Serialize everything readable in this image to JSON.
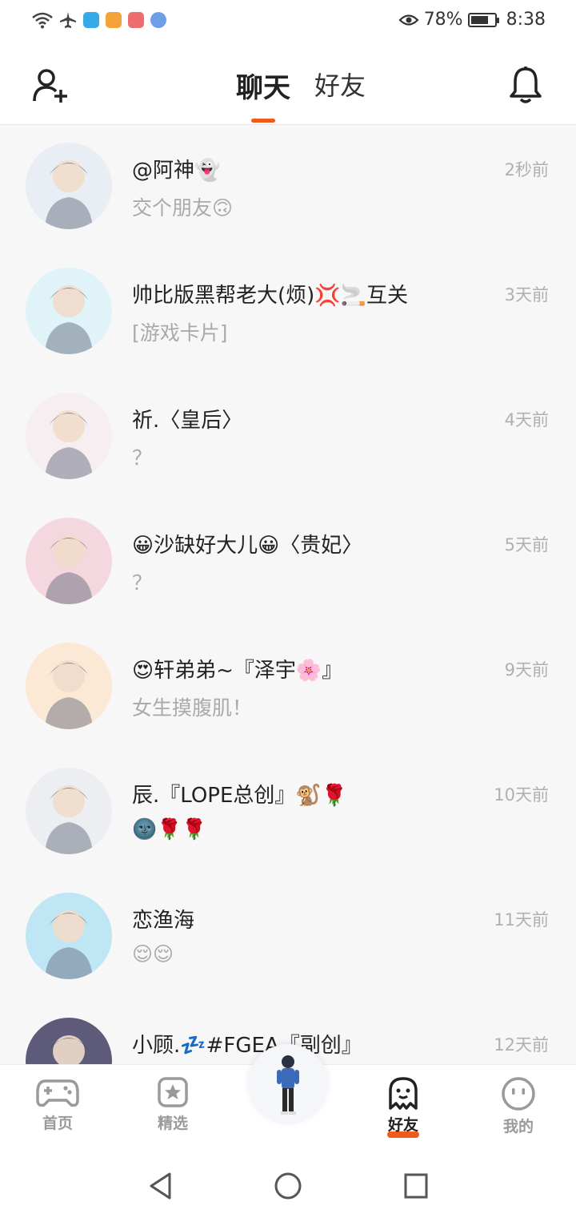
{
  "status_bar": {
    "battery_percent": "78%",
    "battery_level": 0.78,
    "time": "8:38",
    "icons": [
      "wifi-icon",
      "airplane-icon",
      "app-shield-icon",
      "app-play-icon",
      "app-mail-icon",
      "app-globe-icon",
      "eye-comfort-icon",
      "battery-icon"
    ]
  },
  "header": {
    "tabs": [
      {
        "label": "聊天",
        "active": true
      },
      {
        "label": "好友",
        "active": false
      }
    ],
    "left_icon": "add-friend-icon",
    "right_icon": "bell-icon"
  },
  "chats": [
    {
      "name": "@阿神👻",
      "preview": "交个朋友🙃",
      "time": "2秒前",
      "avatar_bg": "#e8eef4"
    },
    {
      "name": "帅比版黑帮老大(烦)💢🚬互关",
      "preview": "[游戏卡片]",
      "time": "3天前",
      "avatar_bg": "#dff3f8"
    },
    {
      "name": "祈.〈皇后〉",
      "preview": "？",
      "time": "4天前",
      "avatar_bg": "#f6eef1"
    },
    {
      "name": "😀沙缺好大儿😀〈贵妃〉",
      "preview": "？",
      "time": "5天前",
      "avatar_bg": "#f5d8df"
    },
    {
      "name": "😍轩弟弟~『泽宇🌸』",
      "preview": "女生摸腹肌！",
      "time": "9天前",
      "avatar_bg": "#fbe9d6"
    },
    {
      "name": "辰.『LOPE总创』🐒🌹",
      "preview": "🌚🌹🌹",
      "time": "10天前",
      "avatar_bg": "#eceef2"
    },
    {
      "name": "恋渔海",
      "preview": "😌😌",
      "time": "11天前",
      "avatar_bg": "#bfe6f4"
    },
    {
      "name": "小顾.💤#FGEA『副创』",
      "preview": "",
      "time": "12天前",
      "avatar_bg": "#5d5a7a"
    }
  ],
  "bottom_nav": {
    "items": [
      {
        "label": "首页",
        "icon": "gamepad-icon",
        "active": false
      },
      {
        "label": "精选",
        "icon": "star-card-icon",
        "active": false
      },
      {
        "label": "好友",
        "icon": "ghost-icon",
        "active": true
      },
      {
        "label": "我的",
        "icon": "face-icon",
        "active": false
      }
    ],
    "center_icon": "character-avatar-icon"
  },
  "system_nav": {
    "icons": [
      "back-icon",
      "home-icon",
      "recents-icon"
    ]
  },
  "colors": {
    "accent": "#f05a1a",
    "time_text": "#b0b0b0",
    "preview_text": "#aaaaaa"
  }
}
